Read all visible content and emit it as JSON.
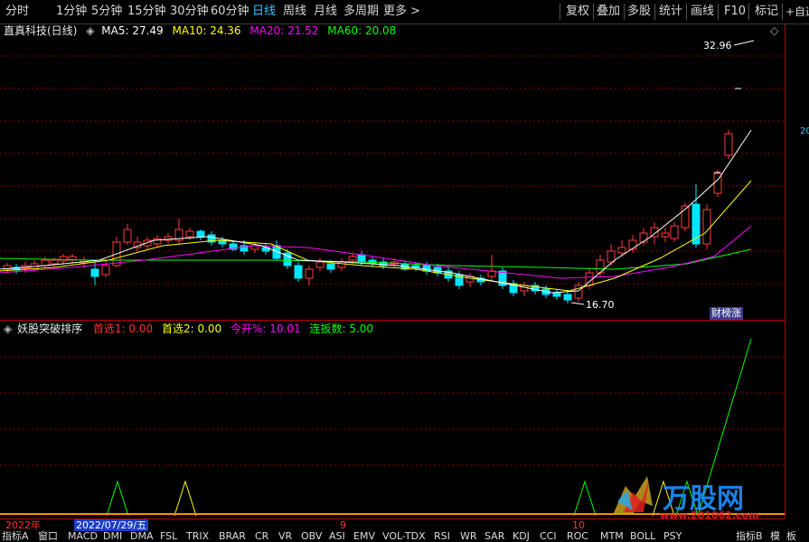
{
  "toolbar": {
    "periods": [
      "分时",
      "1分钟",
      "5分钟",
      "15分钟",
      "30分钟",
      "60分钟",
      "日线",
      "周线",
      "月线",
      "多周期",
      "更多 >"
    ],
    "active_period": "日线",
    "right_buttons": [
      "复权",
      "叠加",
      "多股",
      "统计",
      "画线",
      "F10",
      "标记",
      "+自选"
    ]
  },
  "stock": {
    "name": "直真科技(日线)",
    "ma5_label": "MA5: 27.49",
    "ma10_label": "MA10: 24.36",
    "ma20_label": "MA20: 21.52",
    "ma60_label": "MA60: 20.08",
    "high_marker": "32.96",
    "low_marker": "16.70",
    "badge": "财榜涨",
    "right_price": "20"
  },
  "indicator": {
    "name": "妖股突破排序",
    "sel1_label": "首选1: 0.00",
    "sel2_label": "首选2: 0.00",
    "open_label": "今开%: 10.01",
    "lianban_label": "连扳数: 5.00"
  },
  "axis": {
    "year_label": "2022年",
    "cursor_date": "2022/07/29/五",
    "month_9": "9",
    "month_10": "10"
  },
  "bottom_tabs": [
    "指标A",
    "窗口",
    "MACD",
    "DMI",
    "DMA",
    "FSL",
    "TRIX",
    "BRAR",
    "CR",
    "VR",
    "OBV",
    "ASI",
    "EMV",
    "VOL-TDX",
    "RSI",
    "WR",
    "SAR",
    "KDJ",
    "CCI",
    "ROC",
    "MTM",
    "BOLL",
    "PSY",
    "指标B",
    "模",
    "板"
  ],
  "watermark": {
    "brand": "万股网",
    "url": "www.201062.com"
  },
  "colors": {
    "ma5": "#ffffff",
    "ma10": "#ffff00",
    "ma20": "#ff00ff",
    "ma60": "#00ff00",
    "up": "#ff3b3b",
    "down": "#00e5ff",
    "grid": "#8b0000",
    "active": "#36c5ff"
  }
}
